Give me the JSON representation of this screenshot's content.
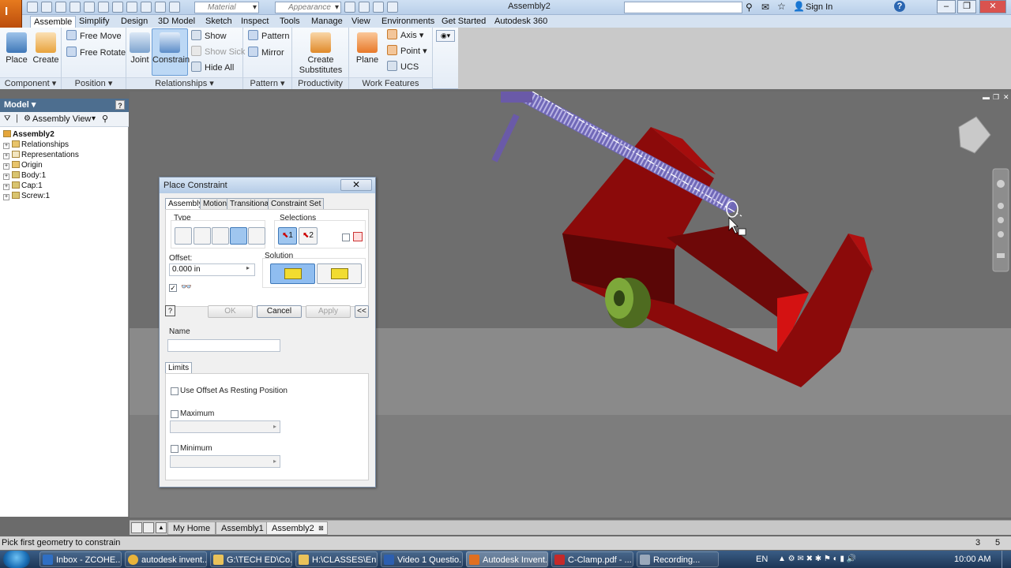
{
  "titlebar": {
    "material_placeholder": "Material",
    "appearance_placeholder": "Appearance",
    "document_title": "Assembly2",
    "signin": "Sign In",
    "help": "?",
    "minimize": "–",
    "restore": "❐",
    "close": "✕"
  },
  "ribbon_tabs": [
    "Assemble",
    "Simplify",
    "Design",
    "3D Model",
    "Sketch",
    "Inspect",
    "Tools",
    "Manage",
    "View",
    "Environments",
    "Get Started",
    "Autodesk 360"
  ],
  "ribbon": {
    "component": {
      "label": "Component",
      "place": "Place",
      "create": "Create"
    },
    "position": {
      "label": "Position",
      "free_move": "Free Move",
      "free_rotate": "Free Rotate"
    },
    "relationships": {
      "label": "Relationships",
      "joint": "Joint",
      "constrain": "Constrain",
      "show": "Show",
      "show_sick": "Show Sick",
      "hide_all": "Hide All"
    },
    "pattern": {
      "label": "Pattern",
      "pattern": "Pattern",
      "mirror": "Mirror"
    },
    "productivity": {
      "label": "Productivity",
      "create_substitutes_1": "Create",
      "create_substitutes_2": "Substitutes"
    },
    "work_features": {
      "label": "Work Features",
      "plane": "Plane",
      "axis": "Axis",
      "point": "Point",
      "ucs": "UCS"
    }
  },
  "browser": {
    "title": "Model",
    "help": "?",
    "view": "Assembly View",
    "items": [
      "Assembly2",
      "Relationships",
      "Representations",
      "Origin",
      "Body:1",
      "Cap:1",
      "Screw:1"
    ]
  },
  "dialog": {
    "title": "Place Constraint",
    "tabs": [
      "Assembly",
      "Motion",
      "Transitional",
      "Constraint Set"
    ],
    "type_label": "Type",
    "selections_label": "Selections",
    "sel1": "1",
    "sel2": "2",
    "offset_label": "Offset:",
    "offset_value": "0.000 in",
    "solution_label": "Solution",
    "ok": "OK",
    "cancel": "Cancel",
    "apply": "Apply",
    "expand": "<<",
    "name_label": "Name",
    "name_value": "",
    "limits_tab": "Limits",
    "use_offset": "Use Offset As Resting Position",
    "maximum": "Maximum",
    "minimum": "Minimum"
  },
  "doc_tabs": [
    "My Home",
    "Assembly1",
    "Assembly2"
  ],
  "status": {
    "message": "Pick first geometry to constrain",
    "num1": "3",
    "num2": "5"
  },
  "taskbar": {
    "items": [
      "Inbox - ZCOHE...",
      "autodesk invent...",
      "G:\\TECH ED\\Co...",
      "H:\\CLASSES\\En...",
      "Video 1 Questio...",
      "Autodesk Invent...",
      "C-Clamp.pdf - ...",
      "Recording..."
    ],
    "lang": "EN",
    "time": "10:00 AM"
  },
  "colors": {
    "clamp": "#8b0a0a",
    "screw": "#6a5aa8",
    "cap": "#6b8f2a",
    "ribbon_accent": "#2b66b1"
  }
}
